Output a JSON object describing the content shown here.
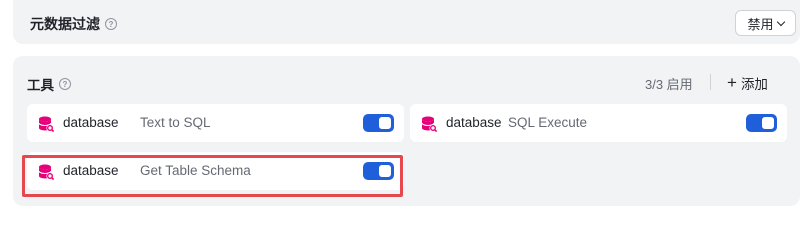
{
  "metadata_filter": {
    "title": "元数据过滤",
    "help_icon": "question-circle-icon",
    "select_value": "禁用"
  },
  "tools": {
    "title": "工具",
    "help_icon": "question-circle-icon",
    "enabled_count": "3/3 启用",
    "add_label": "添加",
    "items": [
      {
        "provider": "database",
        "name": "Text to SQL",
        "icon": "database-icon",
        "enabled": true
      },
      {
        "provider": "database",
        "name": "SQL Execute",
        "icon": "database-icon",
        "enabled": true
      },
      {
        "provider": "database",
        "name": "Get Table Schema",
        "icon": "database-icon",
        "enabled": true,
        "highlighted": true
      }
    ]
  },
  "colors": {
    "toggle_on": "#1f5fd9",
    "highlight": "#e5484d",
    "icon": "#e6007a",
    "card_bg": "#f2f3f5"
  }
}
